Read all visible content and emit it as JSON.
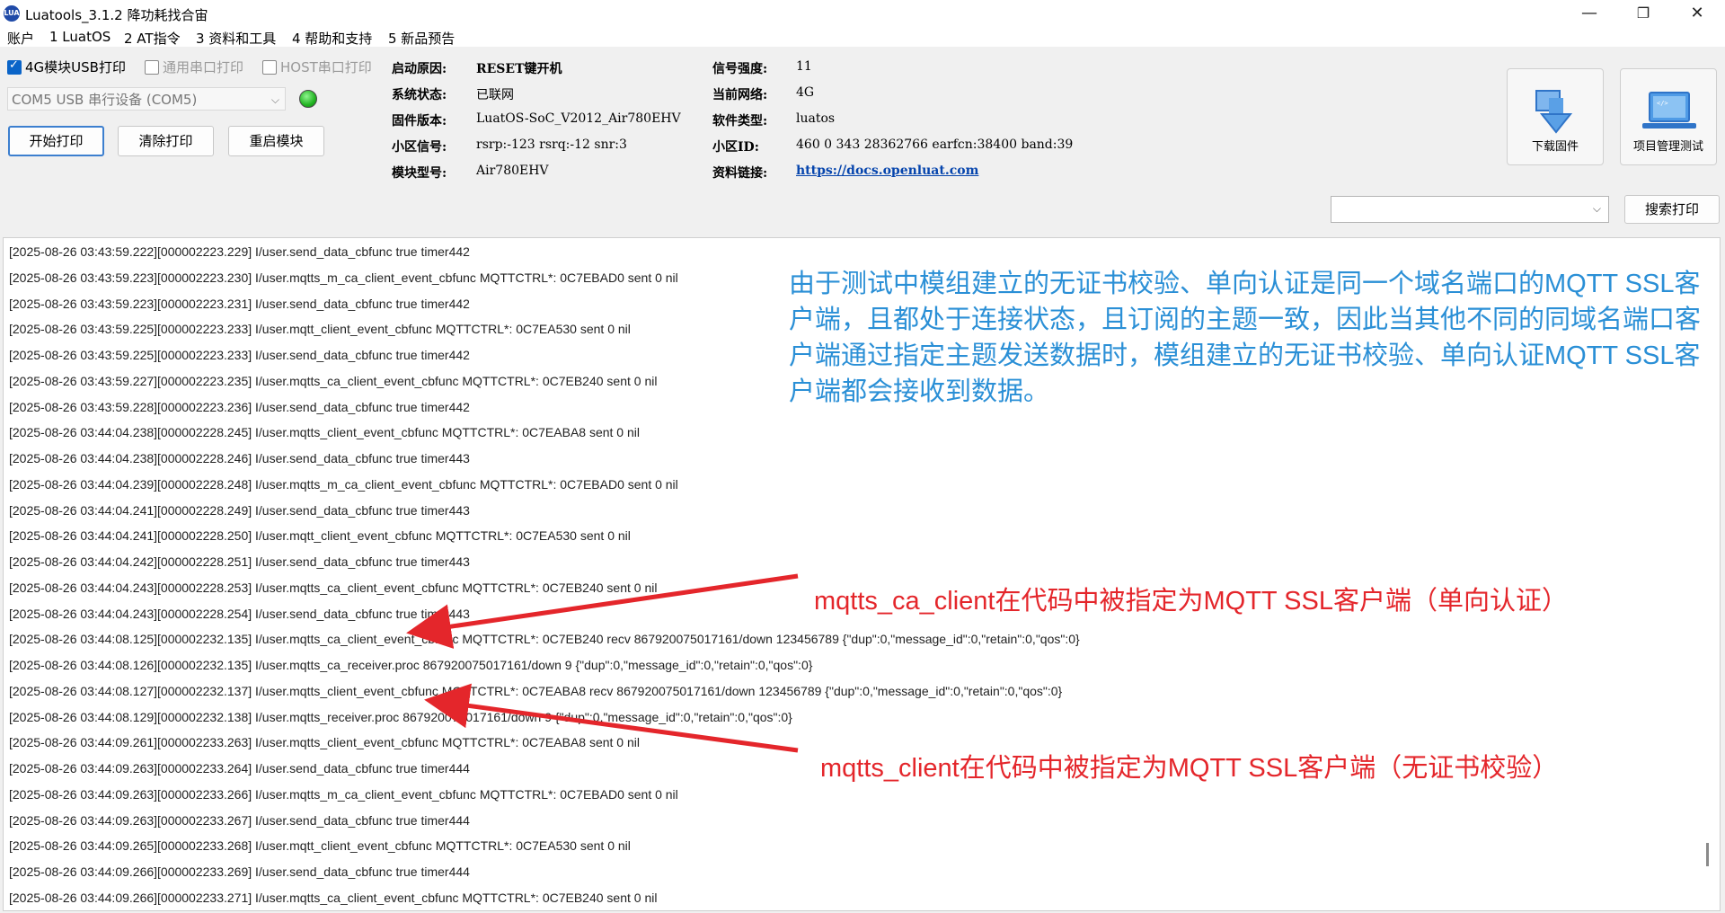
{
  "window": {
    "title": "Luatools_3.1.2 降功耗找合宙",
    "minimize": "—",
    "maximize": "❐",
    "close": "✕",
    "app_icon_text": "LUA"
  },
  "menu": [
    "账户",
    "1 LuatOS",
    "2 AT指令",
    "3 资料和工具",
    "4 帮助和支持",
    "5 新品预告"
  ],
  "options": {
    "usb_print": {
      "label": "4G模块USB打印",
      "checked": true
    },
    "serial_print": {
      "label": "通用串口打印",
      "checked": false
    },
    "host_print": {
      "label": "HOST串口打印",
      "checked": false
    }
  },
  "com_port": {
    "value": "COM5 USB 串行设备 (COM5)",
    "status_color": "#22b422"
  },
  "buttons": {
    "start_print": "开始打印",
    "clear_print": "清除打印",
    "restart_module": "重启模块"
  },
  "info": {
    "boot_reason": {
      "label": "启动原因:",
      "value": "RESET键开机"
    },
    "system_state": {
      "label": "系统状态:",
      "value": "已联网"
    },
    "firmware": {
      "label": "固件版本:",
      "value": "LuatOS-SoC_V2012_Air780EHV"
    },
    "cell_signal": {
      "label": "小区信号:",
      "value": "rsrp:-123 rsrq:-12 snr:3"
    },
    "module_model": {
      "label": "模块型号:",
      "value": "Air780EHV"
    },
    "signal_strength": {
      "label": "信号强度:",
      "value": "11"
    },
    "current_network": {
      "label": "当前网络:",
      "value": "4G"
    },
    "software_type": {
      "label": "软件类型:",
      "value": "luatos"
    },
    "cell_id": {
      "label": "小区ID:",
      "value": "460 0 343 28362766 earfcn:38400 band:39"
    },
    "resource_link": {
      "label": "资料链接:",
      "value": "https://docs.openluat.com"
    }
  },
  "tools": {
    "download_firmware": "下载固件",
    "project_test": "项目管理测试"
  },
  "search": {
    "value": "",
    "button": "搜索打印"
  },
  "log_lines": [
    "[2025-08-26 03:43:59.222][000002223.229] I/user.send_data_cbfunc true timer442",
    "[2025-08-26 03:43:59.223][000002223.230] I/user.mqtts_m_ca_client_event_cbfunc MQTTCTRL*: 0C7EBAD0 sent 0 nil",
    "[2025-08-26 03:43:59.223][000002223.231] I/user.send_data_cbfunc true timer442",
    "[2025-08-26 03:43:59.225][000002223.233] I/user.mqtt_client_event_cbfunc MQTTCTRL*: 0C7EA530 sent 0 nil",
    "[2025-08-26 03:43:59.225][000002223.233] I/user.send_data_cbfunc true timer442",
    "[2025-08-26 03:43:59.227][000002223.235] I/user.mqtts_ca_client_event_cbfunc MQTTCTRL*: 0C7EB240 sent 0 nil",
    "[2025-08-26 03:43:59.228][000002223.236] I/user.send_data_cbfunc true timer442",
    "[2025-08-26 03:44:04.238][000002228.245] I/user.mqtts_client_event_cbfunc MQTTCTRL*: 0C7EABA8 sent 0 nil",
    "[2025-08-26 03:44:04.238][000002228.246] I/user.send_data_cbfunc true timer443",
    "[2025-08-26 03:44:04.239][000002228.248] I/user.mqtts_m_ca_client_event_cbfunc MQTTCTRL*: 0C7EBAD0 sent 0 nil",
    "[2025-08-26 03:44:04.241][000002228.249] I/user.send_data_cbfunc true timer443",
    "[2025-08-26 03:44:04.241][000002228.250] I/user.mqtt_client_event_cbfunc MQTTCTRL*: 0C7EA530 sent 0 nil",
    "[2025-08-26 03:44:04.242][000002228.251] I/user.send_data_cbfunc true timer443",
    "[2025-08-26 03:44:04.243][000002228.253] I/user.mqtts_ca_client_event_cbfunc MQTTCTRL*: 0C7EB240 sent 0 nil",
    "[2025-08-26 03:44:04.243][000002228.254] I/user.send_data_cbfunc true timer443",
    "[2025-08-26 03:44:08.125][000002232.135] I/user.mqtts_ca_client_event_cbfunc MQTTCTRL*: 0C7EB240 recv 867920075017161/down 123456789 {\"dup\":0,\"message_id\":0,\"retain\":0,\"qos\":0}",
    "[2025-08-26 03:44:08.126][000002232.135] I/user.mqtts_ca_receiver.proc 867920075017161/down 9 {\"dup\":0,\"message_id\":0,\"retain\":0,\"qos\":0}",
    "[2025-08-26 03:44:08.127][000002232.137] I/user.mqtts_client_event_cbfunc MQTTCTRL*: 0C7EABA8 recv 867920075017161/down 123456789 {\"dup\":0,\"message_id\":0,\"retain\":0,\"qos\":0}",
    "[2025-08-26 03:44:08.129][000002232.138] I/user.mqtts_receiver.proc 867920075017161/down 9 {\"dup\":0,\"message_id\":0,\"retain\":0,\"qos\":0}",
    "[2025-08-26 03:44:09.261][000002233.263] I/user.mqtts_client_event_cbfunc MQTTCTRL*: 0C7EABA8 sent 0 nil",
    "[2025-08-26 03:44:09.263][000002233.264] I/user.send_data_cbfunc true timer444",
    "[2025-08-26 03:44:09.263][000002233.266] I/user.mqtts_m_ca_client_event_cbfunc MQTTCTRL*: 0C7EBAD0 sent 0 nil",
    "[2025-08-26 03:44:09.263][000002233.267] I/user.send_data_cbfunc true timer444",
    "[2025-08-26 03:44:09.265][000002233.268] I/user.mqtt_client_event_cbfunc MQTTCTRL*: 0C7EA530 sent 0 nil",
    "[2025-08-26 03:44:09.266][000002233.269] I/user.send_data_cbfunc true timer444",
    "[2025-08-26 03:44:09.266][000002233.271] I/user.mqtts_ca_client_event_cbfunc MQTTCTRL*: 0C7EB240 sent 0 nil"
  ],
  "annotations": {
    "note_blue": "由于测试中模组建立的无证书校验、单向认证是同一个域名端口的MQTT SSL客户端，且都处于连接状态，且订阅的主题一致，因此当其他不同的同域名端口客户端通过指定主题发送数据时，模组建立的无证书校验、单向认证MQTT SSL客户端都会接收到数据。",
    "note_red_1": "mqtts_ca_client在代码中被指定为MQTT SSL客户端（单向认证）",
    "note_red_2": "mqtts_client在代码中被指定为MQTT SSL客户端（无证书校验）",
    "blue_color": "#2a8fd6",
    "red_color": "#e4262b"
  }
}
